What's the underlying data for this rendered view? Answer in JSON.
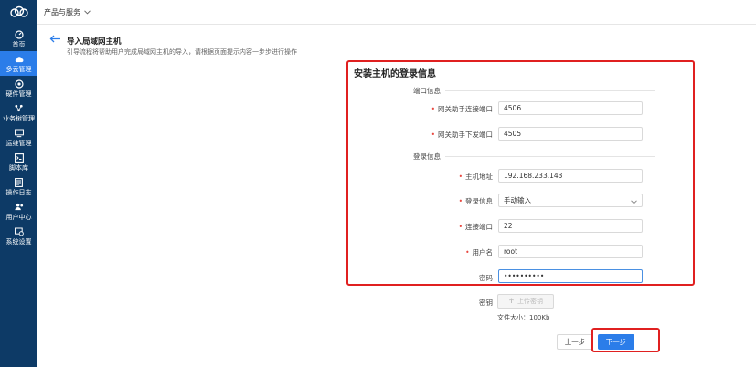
{
  "topbar": {
    "product_menu": "产品与服务"
  },
  "sidebar": {
    "items": [
      {
        "label": "首页"
      },
      {
        "label": "多云管理"
      },
      {
        "label": "硬件管理"
      },
      {
        "label": "业务树管理"
      },
      {
        "label": "运维管理"
      },
      {
        "label": "脚本库"
      },
      {
        "label": "操作日志"
      },
      {
        "label": "用户中心"
      },
      {
        "label": "系统设置"
      }
    ],
    "active_index": 1
  },
  "page": {
    "title": "导入局域网主机",
    "description": "引导流程将帮助用户完成局域网主机的导入，请根据页面提示内容一步步进行操作"
  },
  "form": {
    "title": "安装主机的登录信息",
    "port_section": "端口信息",
    "login_section": "登录信息",
    "fields": {
      "agent_connect_port": {
        "label": "网关助手连接端口",
        "value": "4506"
      },
      "agent_dispatch_port": {
        "label": "网关助手下发端口",
        "value": "4505"
      },
      "host_address": {
        "label": "主机地址",
        "value": "192.168.233.143"
      },
      "login_info": {
        "label": "登录信息",
        "value": "手动输入"
      },
      "connect_port": {
        "label": "连接端口",
        "value": "22"
      },
      "username": {
        "label": "用户名",
        "value": "root"
      },
      "password": {
        "label": "密码",
        "value": "••••••••••"
      }
    },
    "key": {
      "label": "密钥",
      "upload_label": "上传密钥",
      "file_size": "文件大小：100Kb"
    }
  },
  "actions": {
    "prev": "上一步",
    "next": "下一步"
  },
  "colors": {
    "sidebar": "#0d3a66",
    "accent": "#2b7de9",
    "highlight": "#e02020",
    "required": "#e8473f"
  }
}
